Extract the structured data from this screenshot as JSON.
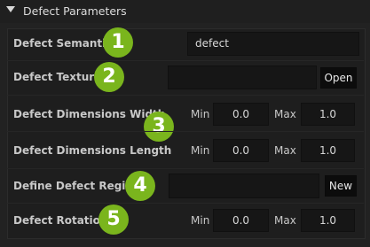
{
  "header": {
    "title": "Defect Parameters",
    "expanded_icon": "triangle-down-icon"
  },
  "rows": {
    "semantic": {
      "label": "Defect Semantic",
      "value": "defect",
      "badge": "1"
    },
    "texture": {
      "label": "Defect Texture",
      "value": "",
      "button": "Open",
      "badge": "2"
    },
    "width": {
      "label": "Defect Dimensions Width",
      "min_label": "Min",
      "min_value": "0.0",
      "max_label": "Max",
      "max_value": "1.0"
    },
    "length": {
      "label": "Defect Dimensions Length",
      "min_label": "Min",
      "min_value": "0.0",
      "max_label": "Max",
      "max_value": "1.0"
    },
    "dimensions_badge": "3",
    "region": {
      "label": "Define Defect Region",
      "value": "",
      "button": "New",
      "badge": "4"
    },
    "rotation": {
      "label": "Defect Rotation",
      "min_label": "Min",
      "min_value": "0.0",
      "max_label": "Max",
      "max_value": "1.0",
      "badge": "5"
    }
  },
  "colors": {
    "badge": "#7ab51d",
    "background": "#222222",
    "field": "#161616"
  }
}
